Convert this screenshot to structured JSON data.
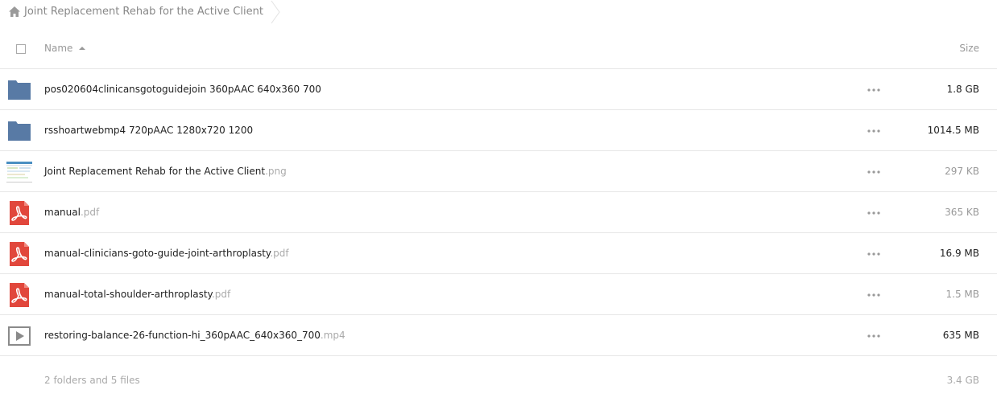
{
  "breadcrumb": {
    "home_icon": "home-icon",
    "label": "Joint Replacement Rehab for the Active Client"
  },
  "header": {
    "name_label": "Name",
    "size_label": "Size"
  },
  "files": [
    {
      "type": "folder",
      "icon": "folder-icon",
      "name": "pos020604clinicansgotoguidejoin 360pAAC 640x360 700",
      "ext": "",
      "size": "1.8 GB",
      "size_color": "#222222"
    },
    {
      "type": "folder",
      "icon": "folder-icon",
      "name": "rsshoartwebmp4 720pAAC 1280x720 1200",
      "ext": "",
      "size": "1014.5 MB",
      "size_color": "#222222"
    },
    {
      "type": "image",
      "icon": "image-thumbnail",
      "name": "Joint Replacement Rehab for the Active Client",
      "ext": ".png",
      "size": "297 KB",
      "size_color": "#999999"
    },
    {
      "type": "pdf",
      "icon": "pdf-icon",
      "name": "manual",
      "ext": ".pdf",
      "size": "365 KB",
      "size_color": "#999999"
    },
    {
      "type": "pdf",
      "icon": "pdf-icon",
      "name": "manual-clinicians-goto-guide-joint-arthroplasty",
      "ext": ".pdf",
      "size": "16.9 MB",
      "size_color": "#222222"
    },
    {
      "type": "pdf",
      "icon": "pdf-icon",
      "name": "manual-total-shoulder-arthroplasty",
      "ext": ".pdf",
      "size": "1.5 MB",
      "size_color": "#999999"
    },
    {
      "type": "video",
      "icon": "video-icon",
      "name": "restoring-balance-26-function-hi_360pAAC_640x360_700",
      "ext": ".mp4",
      "size": "635 MB",
      "size_color": "#222222"
    }
  ],
  "summary": {
    "text": "2 folders and 5 files",
    "size": "3.4 GB"
  },
  "colors": {
    "folder": "#587aa5",
    "pdf": "#e1473c",
    "divider": "#e6e6e6"
  }
}
